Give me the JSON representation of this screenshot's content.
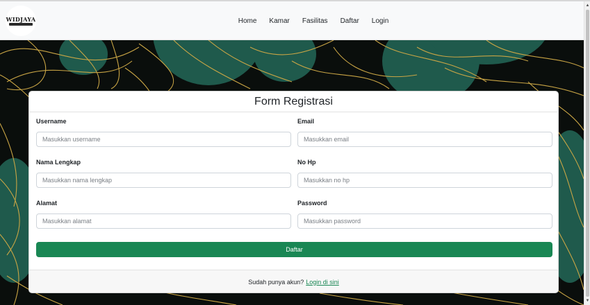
{
  "brand": {
    "logo_text": "WIDJAYA"
  },
  "nav": {
    "items": [
      {
        "label": "Home"
      },
      {
        "label": "Kamar"
      },
      {
        "label": "Fasilitas"
      },
      {
        "label": "Daftar"
      },
      {
        "label": "Login"
      }
    ]
  },
  "form": {
    "title": "Form Registrasi",
    "fields": {
      "username": {
        "label": "Username",
        "placeholder": "Masukkan username"
      },
      "email": {
        "label": "Email",
        "placeholder": "Masukkan email"
      },
      "nama": {
        "label": "Nama Lengkap",
        "placeholder": "Masukkan nama lengkap"
      },
      "nohp": {
        "label": "No Hp",
        "placeholder": "Masukkan no hp"
      },
      "alamat": {
        "label": "Alamat",
        "placeholder": "Masukkan alamat"
      },
      "password": {
        "label": "Password",
        "placeholder": "Masukkan password"
      }
    },
    "submit_label": "Daftar",
    "footer_text": "Sudah punya akun?",
    "footer_link": "Login di sini"
  },
  "colors": {
    "primary_green": "#198754",
    "navbar_bg": "#f8f9fa",
    "hero_dark": "#0a0e0c",
    "leaf_teal": "#1f5a4c",
    "gold_line": "#c9a545"
  },
  "icons": {
    "scroll_up": "triangle-up-icon",
    "scroll_down": "triangle-down-icon"
  }
}
